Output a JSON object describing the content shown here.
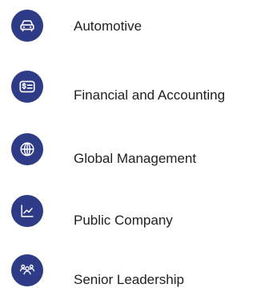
{
  "categories": {
    "items": [
      {
        "label": "Automotive",
        "icon": "car-icon"
      },
      {
        "label": "Financial and Accounting",
        "icon": "dollar-card-icon"
      },
      {
        "label": "Global Management",
        "icon": "globe-icon"
      },
      {
        "label": "Public Company",
        "icon": "trend-chart-icon"
      },
      {
        "label": "Senior Leadership",
        "icon": "group-people-icon"
      }
    ],
    "icon_background": "#2e3b86",
    "icon_foreground": "#ffffff",
    "text_color": "#1f1f1f"
  }
}
